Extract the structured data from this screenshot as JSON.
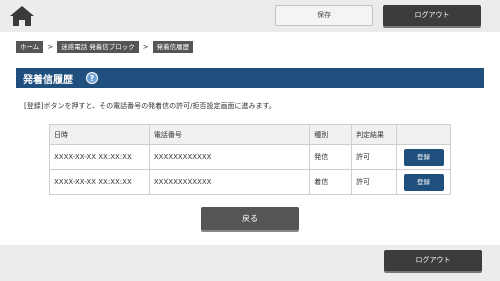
{
  "header": {
    "home_icon": "home-icon",
    "save_label": "保存",
    "logout_label": "ログアウト"
  },
  "breadcrumb": {
    "items": [
      "ホーム",
      "迷惑電話 発着信ブロック",
      "発着信履歴"
    ],
    "separator": ">"
  },
  "section": {
    "title": "発着信履歴",
    "help_icon": "?",
    "color": "#1f4f7d"
  },
  "description": "[登録]ボタンを押すと、その電話番号の発着信の許可/拒否設定画面に進みます。",
  "table": {
    "headers": [
      "日時",
      "電話番号",
      "種別",
      "判定結果",
      ""
    ],
    "rows": [
      {
        "date": "XXXX-XX-XX XX:XX:XX",
        "number": "XXXXXXXXXXXX",
        "type": "発信",
        "result": "許可",
        "action": "登録"
      },
      {
        "date": "XXXX-XX-XX XX:XX:XX",
        "number": "XXXXXXXXXXXX",
        "type": "着信",
        "result": "許可",
        "action": "登録"
      }
    ]
  },
  "back_label": "戻る",
  "footer": {
    "logout_label": "ログアウト"
  }
}
